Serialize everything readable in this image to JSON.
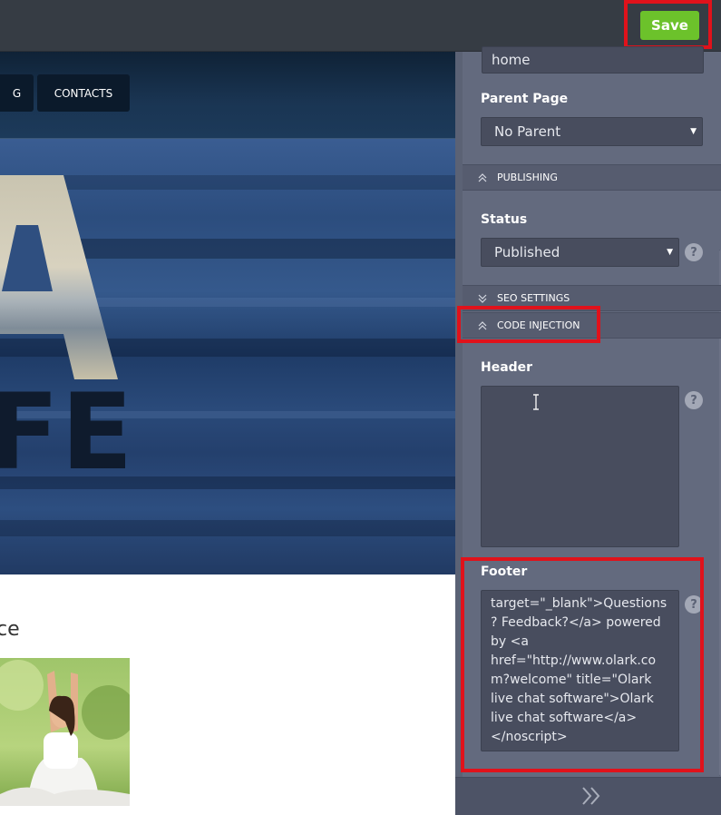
{
  "toolbar": {
    "save_label": "Save"
  },
  "site": {
    "nav": {
      "partial_item": "G",
      "contacts_label": "CONTACTS"
    },
    "hero": {
      "letter_a": "A",
      "letters_fe": "FE"
    },
    "section_title_fragment": "ce"
  },
  "panel": {
    "slug_value": "home",
    "parent_page": {
      "label": "Parent Page",
      "value": "No Parent"
    },
    "publishing": {
      "section_label": "PUBLISHING",
      "status_label": "Status",
      "status_value": "Published"
    },
    "seo": {
      "section_label": "SEO SETTINGS"
    },
    "code_injection": {
      "section_label": "CODE INJECTION",
      "header_label": "Header",
      "header_value": "",
      "footer_label": "Footer",
      "footer_lines": [
        "target=\"_blank\">Questions",
        "? Feedback?</a> powered",
        "by <a",
        "href=\"http://www.olark.co",
        "m?welcome\" title=\"Olark",
        "live chat software\">Olark",
        "live chat software</a>",
        "</noscript>"
      ]
    },
    "help_glyph": "?"
  },
  "colors": {
    "save_green": "#6cc22b",
    "highlight_red": "#e0121b",
    "panel_bg": "#636a7e",
    "topbar": "#363c44"
  }
}
